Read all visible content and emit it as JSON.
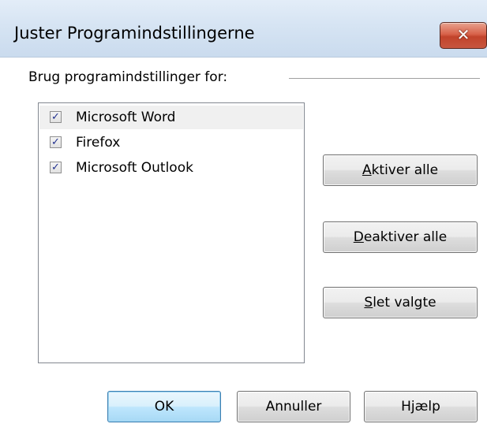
{
  "dialog": {
    "title": "Juster Programindstillingerne",
    "close_glyph": "✕"
  },
  "group": {
    "label": "Brug programindstillinger for:"
  },
  "programs": [
    {
      "label": "Microsoft Word",
      "checked": true,
      "selected": true
    },
    {
      "label": "Firefox",
      "checked": true,
      "selected": false
    },
    {
      "label": "Microsoft Outlook",
      "checked": true,
      "selected": false
    }
  ],
  "check_glyph": "✓",
  "side_buttons": {
    "enable_all": {
      "mnemonic": "A",
      "rest": "ktiver alle"
    },
    "disable_all": {
      "mnemonic": "D",
      "rest": "eaktiver alle"
    },
    "delete_selected": {
      "mnemonic": "S",
      "rest": "let valgte"
    }
  },
  "bottom_buttons": {
    "ok": "OK",
    "cancel": "Annuller",
    "help": "Hjælp"
  },
  "colors": {
    "titlebar": "#d6e4f3",
    "close_button": "#c7563f",
    "default_button_border": "#3c7fb1",
    "selection": "#f0f0f0"
  }
}
